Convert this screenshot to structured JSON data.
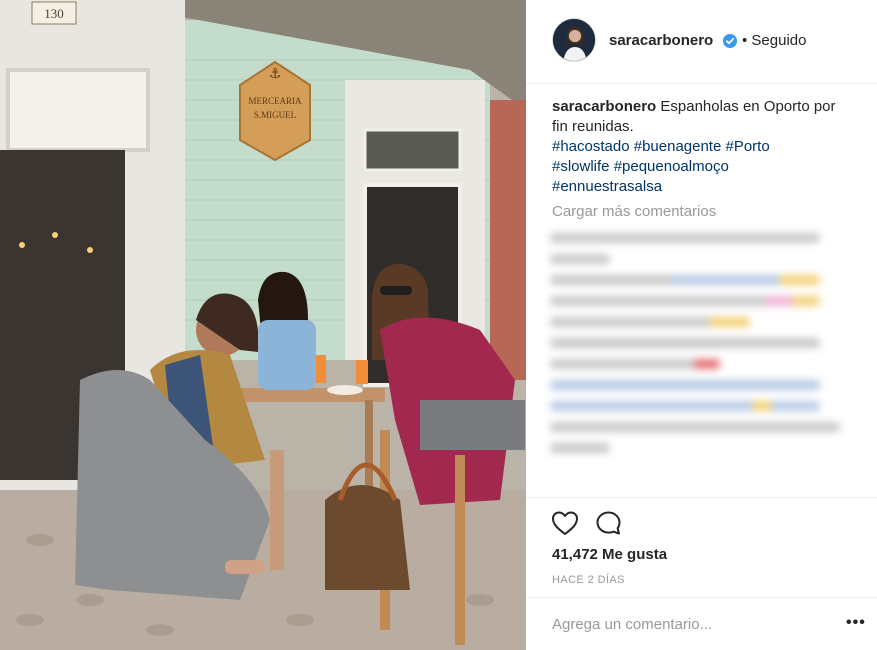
{
  "post": {
    "username": "saracarbonero",
    "follow_status": "• Seguido",
    "caption_user": "saracarbonero",
    "caption_text": "Espanholas en Oporto por fin reunidas.",
    "hashtags": [
      "#hacostado #buenagente #Porto",
      "#slowlife #pequenoalmoço",
      "#ennuestrasalsa"
    ],
    "load_more": "Cargar más comentarios",
    "likes": "41,472 Me gusta",
    "time": "HACE 2 DÍAS",
    "comment_placeholder": "Agrega un comentario...",
    "more_label": "•••"
  },
  "photo": {
    "house_number": "130",
    "sign_line1": "MERCEARIA",
    "sign_line2": "S.MIGUEL"
  },
  "colors": {
    "accent_blue": "#3897f0",
    "hashtag": "#003569",
    "muted": "#999999"
  },
  "icons": [
    "verified-icon",
    "heart-icon",
    "comment-icon",
    "more-options-icon"
  ]
}
